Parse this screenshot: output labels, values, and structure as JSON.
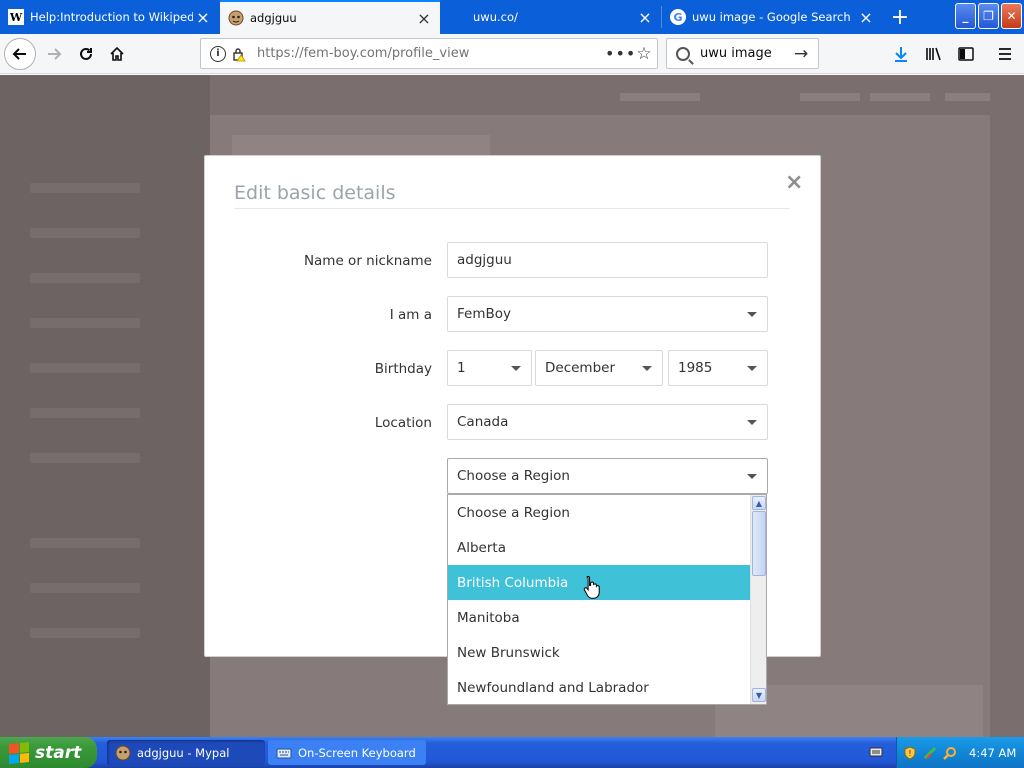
{
  "browser": {
    "tabs": [
      {
        "title": "Help:Introduction to Wikipedia - W",
        "favicon": "W",
        "active": false
      },
      {
        "title": "adgjguu",
        "favicon": "mypal",
        "active": true
      },
      {
        "title": "uwu.co/",
        "favicon": "",
        "active": false
      },
      {
        "title": "uwu image - Google Search",
        "favicon": "G",
        "active": false
      }
    ],
    "url": "https://fem-boy.com/profile_view",
    "search_value": "uwu image",
    "page_actions": "•••"
  },
  "modal": {
    "title": "Edit basic details",
    "close": "×",
    "fields": {
      "name_label": "Name or nickname",
      "name_value": "adgjguu",
      "gender_label": "I am a",
      "gender_value": "FemBoy",
      "birthday_label": "Birthday",
      "birthday_day": "1",
      "birthday_month": "December",
      "birthday_year": "1985",
      "location_label": "Location",
      "location_value": "Canada",
      "region_value": "Choose a Region"
    },
    "region_options": [
      "Choose a Region",
      "Alberta",
      "British Columbia",
      "Manitoba",
      "New Brunswick",
      "Newfoundland and Labrador"
    ],
    "highlighted_option": "British Columbia"
  },
  "taskbar": {
    "start_label": "start",
    "tasks": [
      {
        "label": "adgjguu - Mypal"
      },
      {
        "label": "On-Screen Keyboard"
      }
    ],
    "clock": "4:47 AM"
  },
  "colors": {
    "tab_strip": "#0b5fd8",
    "highlight": "#3fc1d7",
    "taskbar": "#245edb",
    "start_button": "#3a9a3a"
  }
}
